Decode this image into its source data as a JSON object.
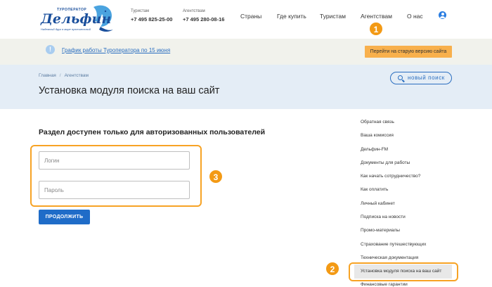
{
  "logo": {
    "top": "ТУРОПЕРАТОР",
    "main": "Дельфин",
    "sub": "Надежный друг в мире путешествий"
  },
  "phones": [
    {
      "label": "Туристам",
      "number": "+7 495 825-25-00"
    },
    {
      "label": "Агентствам",
      "number": "+7 495 280-08-16"
    }
  ],
  "nav": [
    "Страны",
    "Где купить",
    "Туристам",
    "Агентствам",
    "О нас"
  ],
  "notice": {
    "icon": "!",
    "link": "График работы Туроператора по 15 июня",
    "old_site_button": "Перейти на старую версию сайта"
  },
  "breadcrumb": [
    "Главная",
    "/",
    "Агентствам"
  ],
  "page_title": "Установка модуля поиска на ваш сайт",
  "search_button": "новый поиск",
  "section_heading": "Раздел доступен только для авторизованных пользователей",
  "login": {
    "placeholder": "Логин",
    "value": ""
  },
  "password": {
    "placeholder": "Пароль",
    "value": ""
  },
  "submit_label": "ПРОДОЛЖИТЬ",
  "sidebar": [
    "Обратная связь",
    "Ваша комиссия",
    "Дельфин-FM",
    "Документы для работы",
    "Как начать сотрудничество?",
    "Как оплатить",
    "Личный кабинет",
    "Подписка на новости",
    "Промо-материалы",
    "Страхование путешествующих",
    "Техническая документация",
    "Установка модуля поиска на ваш сайт",
    "Финансовые гарантии"
  ],
  "badges": [
    "1",
    "2",
    "3"
  ],
  "colors": {
    "accent": "#1f6cc8",
    "highlight": "#f39a15",
    "notice_bg": "#f1f2ec",
    "title_bg": "#e4edf6",
    "old_site_button": "#f8b04c"
  }
}
